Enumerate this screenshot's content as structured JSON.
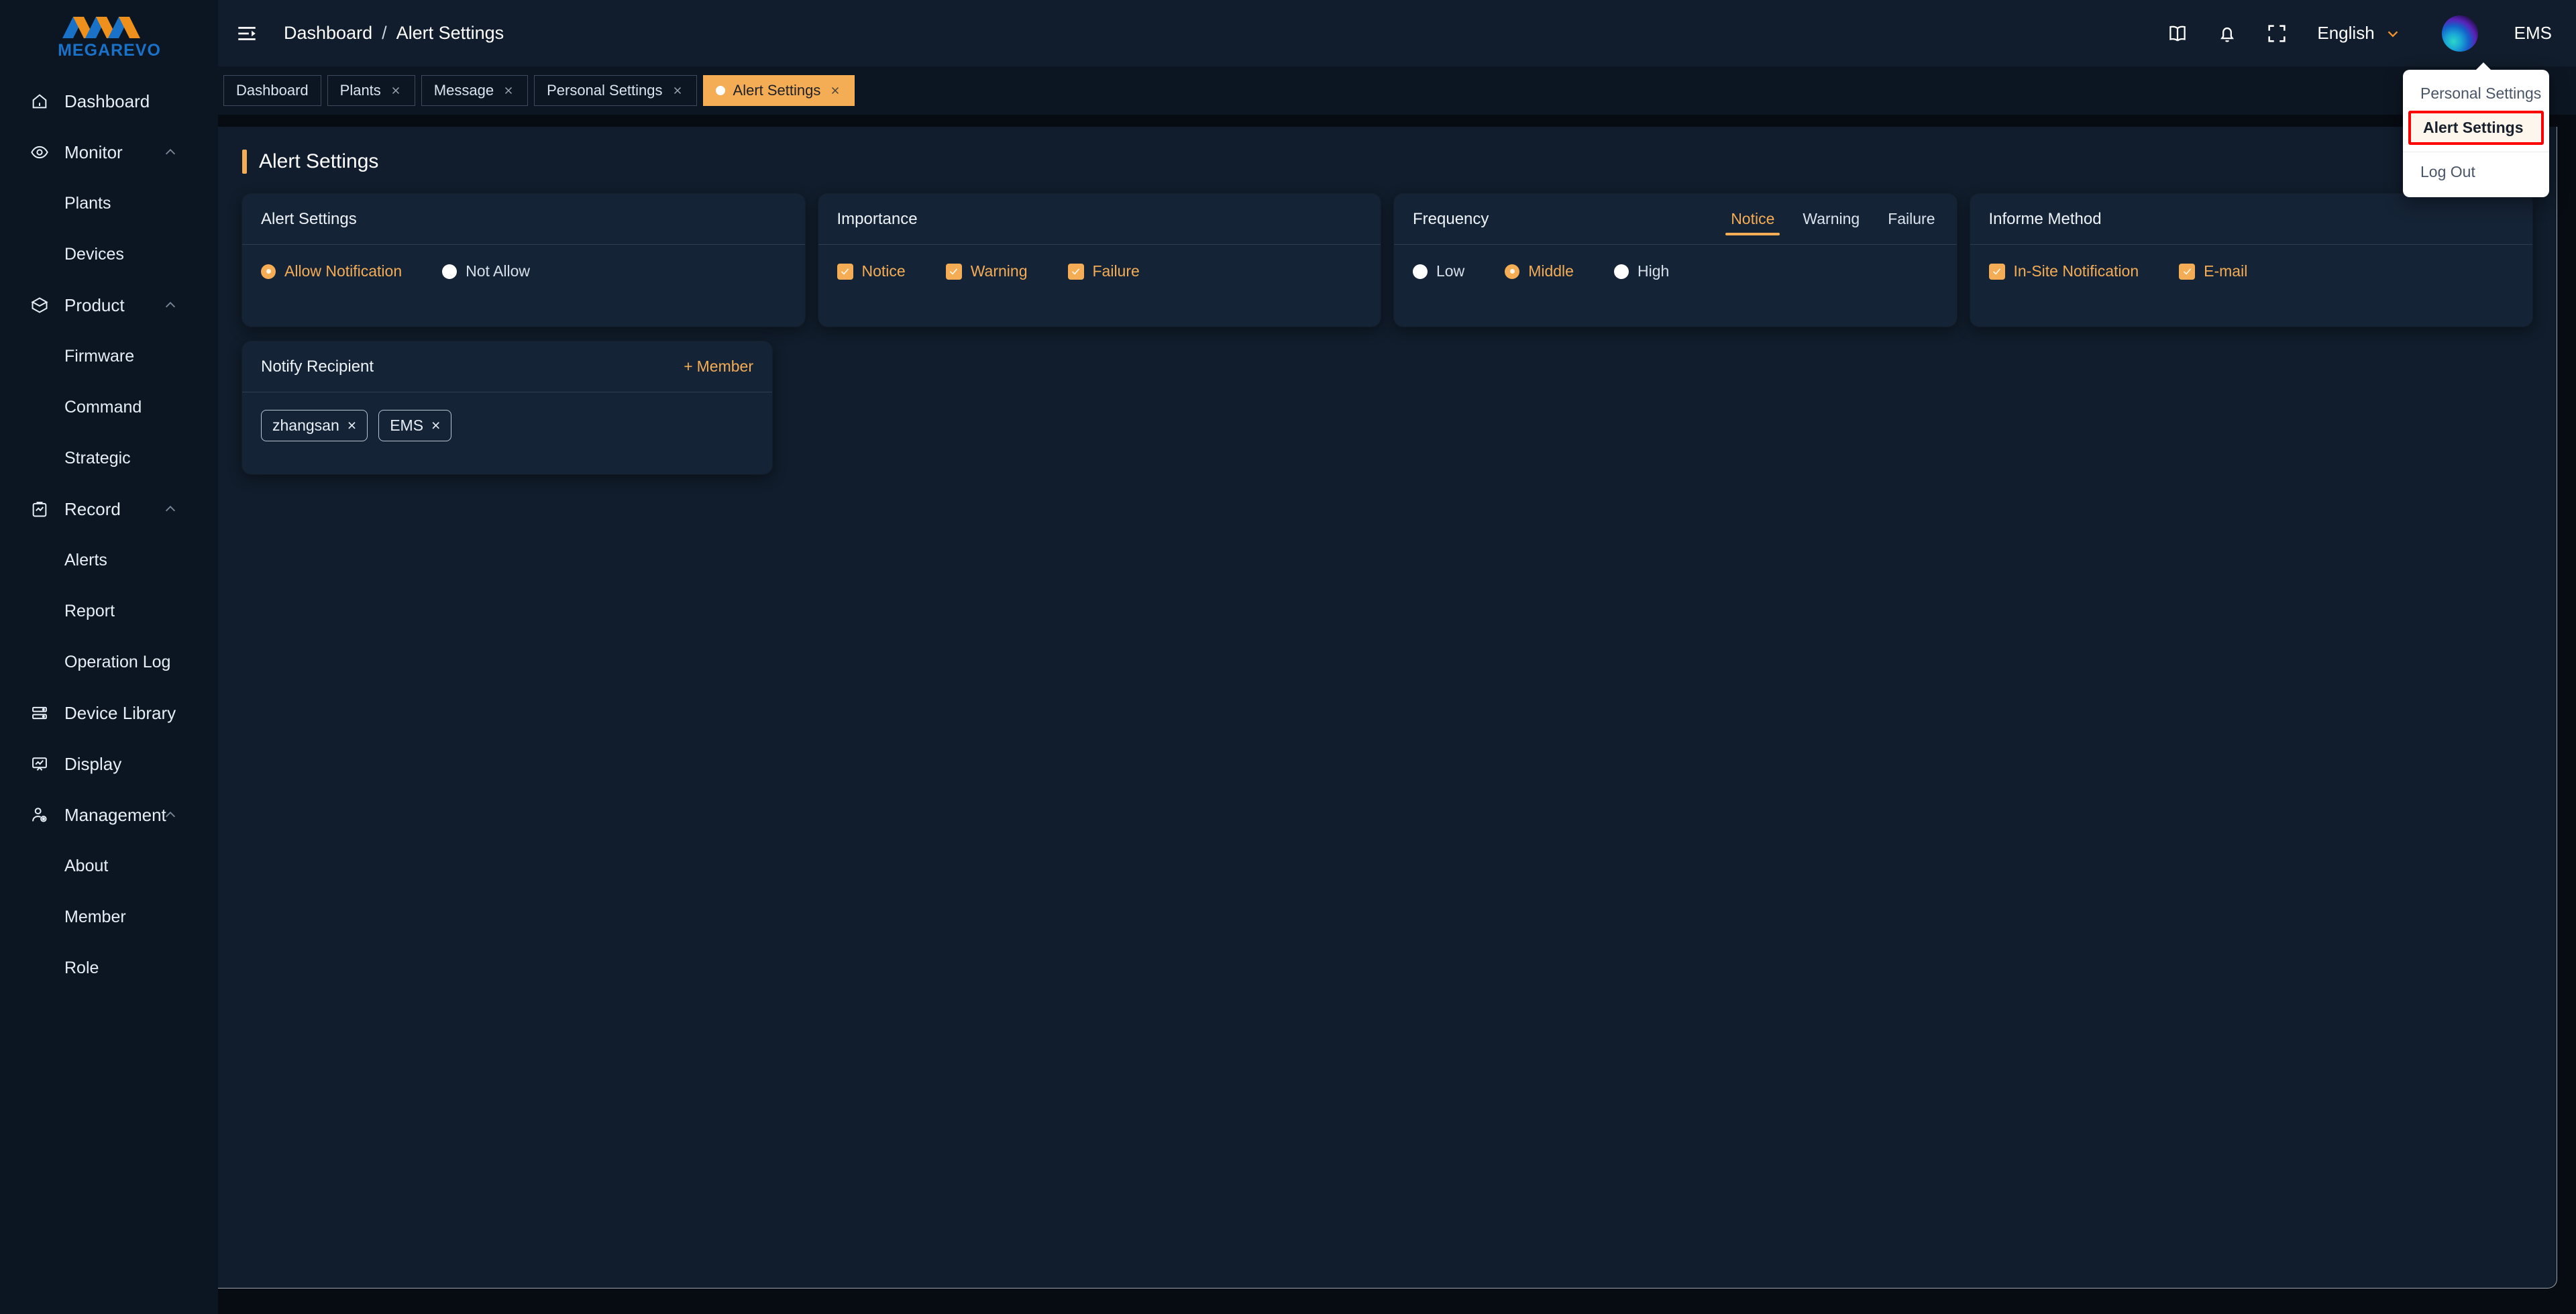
{
  "brand": {
    "name": "MEGAREVO"
  },
  "sidebar": {
    "items": [
      {
        "label": "Dashboard",
        "icon": "home-icon",
        "level": 0,
        "expandable": false
      },
      {
        "label": "Monitor",
        "icon": "eye-icon",
        "level": 0,
        "expandable": true
      },
      {
        "label": "Plants",
        "icon": "",
        "level": 1,
        "expandable": false
      },
      {
        "label": "Devices",
        "icon": "",
        "level": 1,
        "expandable": false
      },
      {
        "label": "Product",
        "icon": "box-icon",
        "level": 0,
        "expandable": true
      },
      {
        "label": "Firmware",
        "icon": "",
        "level": 1,
        "expandable": false
      },
      {
        "label": "Command",
        "icon": "",
        "level": 1,
        "expandable": false
      },
      {
        "label": "Strategic",
        "icon": "",
        "level": 1,
        "expandable": false
      },
      {
        "label": "Record",
        "icon": "clipboard-chart-icon",
        "level": 0,
        "expandable": true
      },
      {
        "label": "Alerts",
        "icon": "",
        "level": 1,
        "expandable": false
      },
      {
        "label": "Report",
        "icon": "",
        "level": 1,
        "expandable": false
      },
      {
        "label": "Operation Log",
        "icon": "",
        "level": 1,
        "expandable": false
      },
      {
        "label": "Device Library",
        "icon": "server-icon",
        "level": 0,
        "expandable": false
      },
      {
        "label": "Display",
        "icon": "presentation-chart-icon",
        "level": 0,
        "expandable": false
      },
      {
        "label": "Management",
        "icon": "user-gear-icon",
        "level": 0,
        "expandable": true
      },
      {
        "label": "About",
        "icon": "",
        "level": 1,
        "expandable": false
      },
      {
        "label": "Member",
        "icon": "",
        "level": 1,
        "expandable": false
      },
      {
        "label": "Role",
        "icon": "",
        "level": 1,
        "expandable": false
      }
    ]
  },
  "topbar": {
    "collapse_icon": "sidebar-collapse-icon",
    "breadcrumb": {
      "root": "Dashboard",
      "separator": "/",
      "current": "Alert Settings"
    },
    "icons": [
      "book-icon",
      "bell-icon",
      "fullscreen-icon"
    ],
    "language": "English",
    "username": "EMS"
  },
  "tabs": [
    {
      "label": "Dashboard",
      "closable": false,
      "active": false
    },
    {
      "label": "Plants",
      "closable": true,
      "active": false
    },
    {
      "label": "Message",
      "closable": true,
      "active": false
    },
    {
      "label": "Personal Settings",
      "closable": true,
      "active": false
    },
    {
      "label": "Alert Settings",
      "closable": true,
      "active": true
    }
  ],
  "page": {
    "title": "Alert Settings"
  },
  "cards": {
    "alert_settings": {
      "title": "Alert Settings",
      "options": [
        {
          "label": "Allow Notification",
          "selected": true
        },
        {
          "label": "Not Allow",
          "selected": false
        }
      ]
    },
    "importance": {
      "title": "Importance",
      "options": [
        {
          "label": "Notice",
          "checked": true
        },
        {
          "label": "Warning",
          "checked": true
        },
        {
          "label": "Failure",
          "checked": true
        }
      ]
    },
    "frequency": {
      "title": "Frequency",
      "tabs": [
        {
          "label": "Notice",
          "active": true
        },
        {
          "label": "Warning",
          "active": false
        },
        {
          "label": "Failure",
          "active": false
        }
      ],
      "options": [
        {
          "label": "Low",
          "selected": false
        },
        {
          "label": "Middle",
          "selected": true
        },
        {
          "label": "High",
          "selected": false
        }
      ]
    },
    "informe_method": {
      "title": "Informe Method",
      "options": [
        {
          "label": "In-Site Notification",
          "checked": true
        },
        {
          "label": "E-mail",
          "checked": true
        }
      ]
    },
    "notify_recipient": {
      "title": "Notify Recipient",
      "add_label": "Member",
      "add_prefix": "+",
      "chips": [
        {
          "label": "zhangsan",
          "remove": "×"
        },
        {
          "label": "EMS",
          "remove": "×"
        }
      ]
    }
  },
  "user_menu": {
    "items": [
      {
        "label": "Personal Settings",
        "highlighted": false
      },
      {
        "label": "Alert Settings",
        "highlighted": true
      },
      {
        "label": "Log Out",
        "highlighted": false
      }
    ]
  },
  "colors": {
    "accent": "#f5ad55",
    "sidebar_bg": "#0c1622",
    "panel_bg": "#111d2c",
    "card_bg": "#152336",
    "page_bg": "#070b12",
    "highlight_border": "#ff0000"
  }
}
